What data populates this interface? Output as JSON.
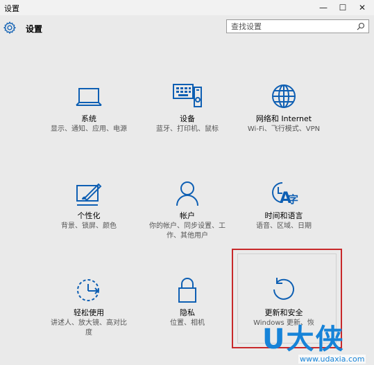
{
  "window": {
    "title": "设置",
    "minimize_glyph": "—",
    "maximize_glyph": "☐",
    "close_glyph": "✕"
  },
  "header": {
    "app_title": "设置",
    "search_placeholder": "查找设置"
  },
  "colors": {
    "accent": "#0e5fb3",
    "highlight_border": "#c8282a",
    "watermark": "#1683d8"
  },
  "tiles": [
    {
      "icon": "laptop-icon",
      "name": "系统",
      "desc": "显示、通知、应用、电源"
    },
    {
      "icon": "devices-icon",
      "name": "设备",
      "desc": "蓝牙、打印机、鼠标"
    },
    {
      "icon": "globe-icon",
      "name": "网络和 Internet",
      "desc": "Wi-Fi、飞行模式、VPN"
    },
    {
      "icon": "personalization-icon",
      "name": "个性化",
      "desc": "背景、锁屏、颜色"
    },
    {
      "icon": "account-icon",
      "name": "帐户",
      "desc": "你的帐户、同步设置、工作、其他用户"
    },
    {
      "icon": "time-language-icon",
      "name": "时间和语言",
      "desc": "语音、区域、日期"
    },
    {
      "icon": "ease-of-access-icon",
      "name": "轻松使用",
      "desc": "讲述人、放大镜、高对比度"
    },
    {
      "icon": "lock-icon",
      "name": "隐私",
      "desc": "位置、相机"
    },
    {
      "icon": "update-icon",
      "name": "更新和安全",
      "desc": "Windows 更新、恢"
    }
  ],
  "watermark": {
    "text": "U大侠",
    "url": "www.udaxia.com"
  }
}
